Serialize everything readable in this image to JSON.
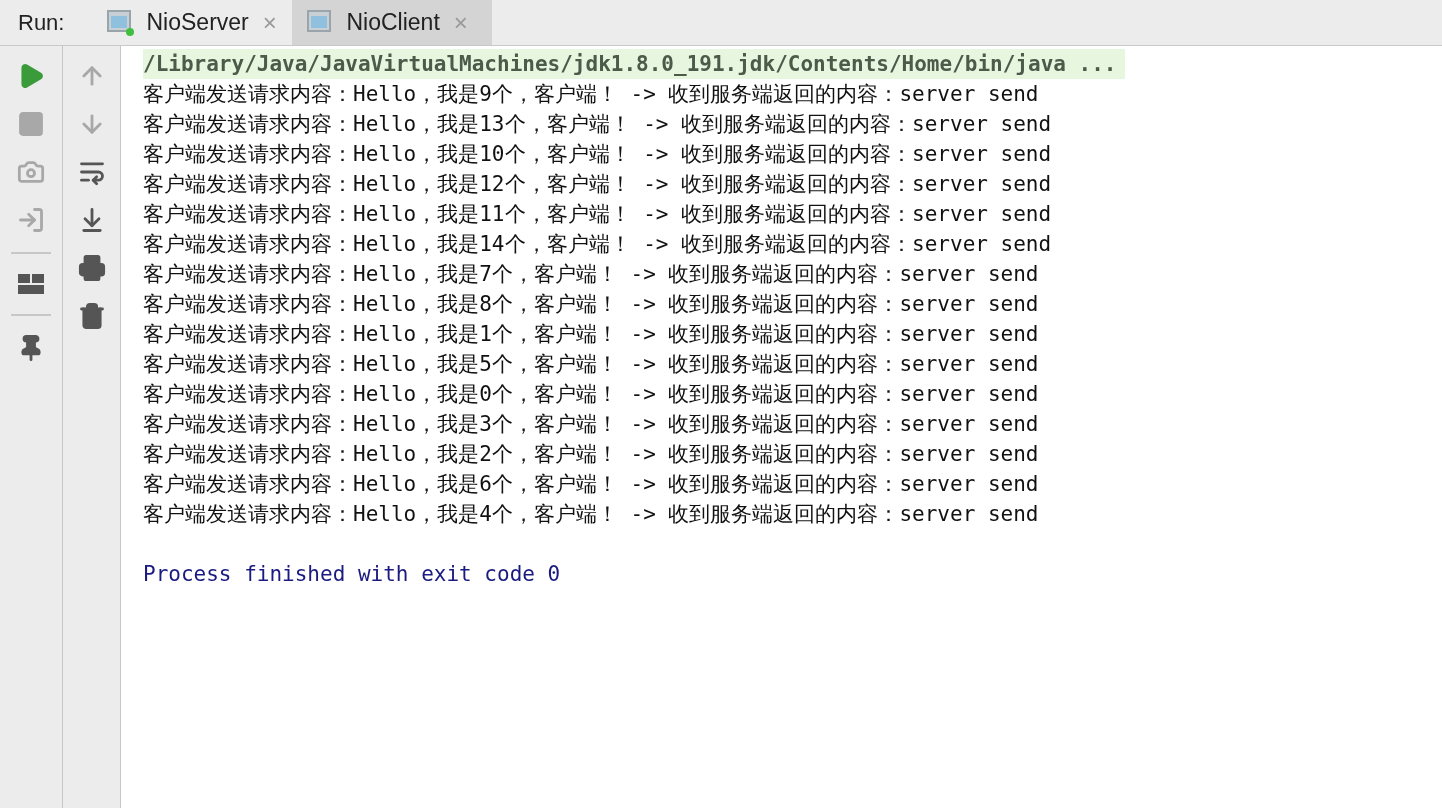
{
  "run_panel": {
    "label": "Run:",
    "tabs": [
      {
        "label": "NioServer",
        "selected": false,
        "running": true,
        "close": "×"
      },
      {
        "label": "NioClient",
        "selected": true,
        "running": false,
        "close": "×"
      }
    ]
  },
  "toolbar_left": [
    {
      "kind": "run",
      "disabled": false
    },
    {
      "kind": "stop",
      "disabled": true
    },
    {
      "kind": "camera",
      "disabled": true
    },
    {
      "kind": "login",
      "disabled": true
    },
    {
      "kind": "separator"
    },
    {
      "kind": "layout",
      "disabled": false
    },
    {
      "kind": "separator"
    },
    {
      "kind": "pin",
      "disabled": false
    }
  ],
  "toolbar_right": [
    {
      "kind": "up",
      "disabled": true
    },
    {
      "kind": "down",
      "disabled": true
    },
    {
      "kind": "wrap",
      "disabled": false
    },
    {
      "kind": "scroll_end",
      "disabled": false
    },
    {
      "kind": "print",
      "disabled": false
    },
    {
      "kind": "trash",
      "disabled": false
    }
  ],
  "console": [
    {
      "kind": "command",
      "text": "/Library/Java/JavaVirtualMachines/jdk1.8.0_191.jdk/Contents/Home/bin/java ..."
    },
    {
      "kind": "output",
      "text": "客户端发送请求内容：Hello，我是9个，客户端！ -> 收到服务端返回的内容：server send"
    },
    {
      "kind": "output",
      "text": "客户端发送请求内容：Hello，我是13个，客户端！ -> 收到服务端返回的内容：server send"
    },
    {
      "kind": "output",
      "text": "客户端发送请求内容：Hello，我是10个，客户端！ -> 收到服务端返回的内容：server send"
    },
    {
      "kind": "output",
      "text": "客户端发送请求内容：Hello，我是12个，客户端！ -> 收到服务端返回的内容：server send"
    },
    {
      "kind": "output",
      "text": "客户端发送请求内容：Hello，我是11个，客户端！ -> 收到服务端返回的内容：server send"
    },
    {
      "kind": "output",
      "text": "客户端发送请求内容：Hello，我是14个，客户端！ -> 收到服务端返回的内容：server send"
    },
    {
      "kind": "output",
      "text": "客户端发送请求内容：Hello，我是7个，客户端！ -> 收到服务端返回的内容：server send"
    },
    {
      "kind": "output",
      "text": "客户端发送请求内容：Hello，我是8个，客户端！ -> 收到服务端返回的内容：server send"
    },
    {
      "kind": "output",
      "text": "客户端发送请求内容：Hello，我是1个，客户端！ -> 收到服务端返回的内容：server send"
    },
    {
      "kind": "output",
      "text": "客户端发送请求内容：Hello，我是5个，客户端！ -> 收到服务端返回的内容：server send"
    },
    {
      "kind": "output",
      "text": "客户端发送请求内容：Hello，我是0个，客户端！ -> 收到服务端返回的内容：server send"
    },
    {
      "kind": "output",
      "text": "客户端发送请求内容：Hello，我是3个，客户端！ -> 收到服务端返回的内容：server send"
    },
    {
      "kind": "output",
      "text": "客户端发送请求内容：Hello，我是2个，客户端！ -> 收到服务端返回的内容：server send"
    },
    {
      "kind": "output",
      "text": "客户端发送请求内容：Hello，我是6个，客户端！ -> 收到服务端返回的内容：server send"
    },
    {
      "kind": "output",
      "text": "客户端发送请求内容：Hello，我是4个，客户端！ -> 收到服务端返回的内容：server send"
    },
    {
      "kind": "blank"
    },
    {
      "kind": "exit",
      "text": "Process finished with exit code 0"
    }
  ]
}
